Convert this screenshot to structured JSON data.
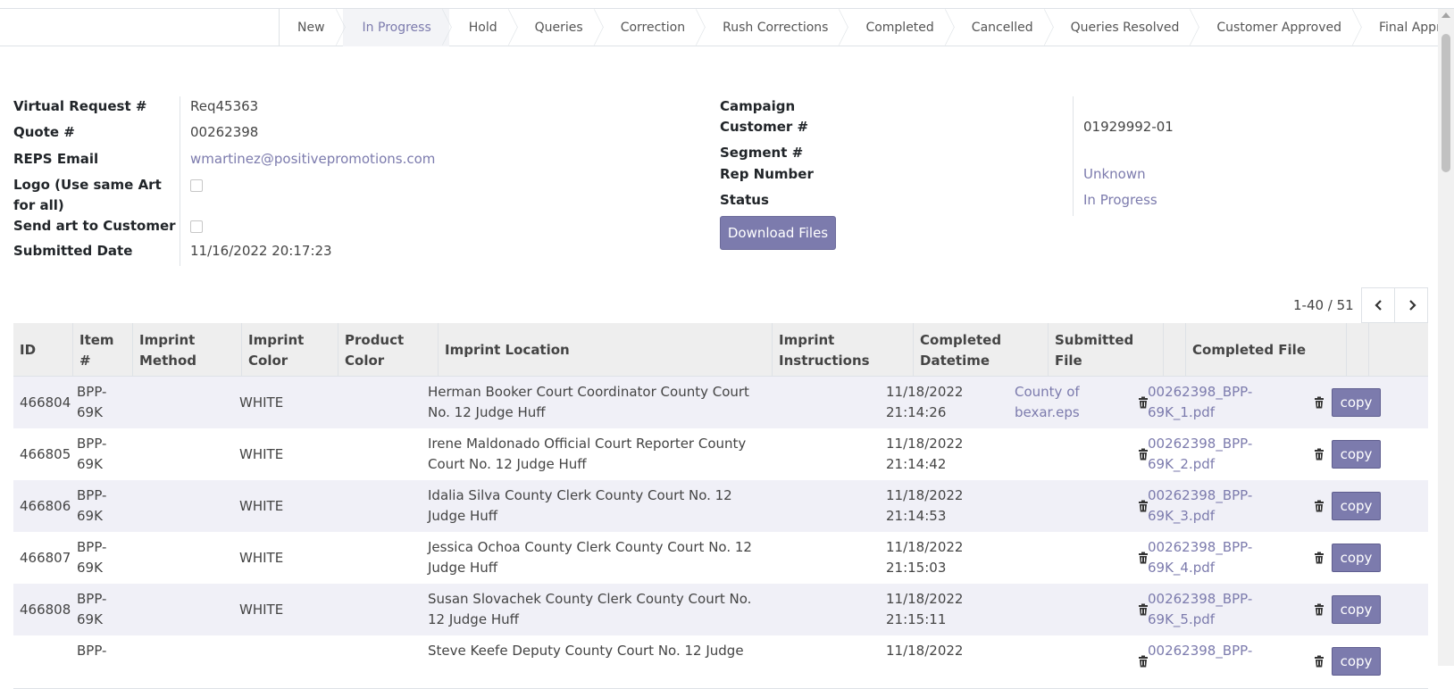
{
  "stages": [
    {
      "label": "New"
    },
    {
      "label": "In Progress",
      "active": true
    },
    {
      "label": "Hold"
    },
    {
      "label": "Queries"
    },
    {
      "label": "Correction"
    },
    {
      "label": "Rush Corrections"
    },
    {
      "label": "Completed"
    },
    {
      "label": "Cancelled"
    },
    {
      "label": "Queries Resolved"
    },
    {
      "label": "Customer Approved"
    },
    {
      "label": "Final Approved"
    }
  ],
  "form": {
    "virtual_request_label": "Virtual Request #",
    "virtual_request_value": "Req45363",
    "quote_label": "Quote #",
    "quote_value": "00262398",
    "reps_email_label": "REPS Email",
    "reps_email_value": "wmartinez@positivepromotions.com",
    "logo_label_line1": "Logo (Use same Art",
    "logo_label_line2": "for all)",
    "send_art_label": "Send art to Customer",
    "submitted_date_label": "Submitted Date",
    "submitted_date_value": "11/16/2022 20:17:23",
    "campaign_label": "Campaign",
    "customer_label": "Customer #",
    "customer_value": "01929992-01",
    "segment_label": "Segment #",
    "rep_number_label": "Rep Number",
    "rep_number_value": "Unknown",
    "status_label": "Status",
    "status_value": "In Progress",
    "download_button": "Download Files"
  },
  "pager": {
    "text": "1-40 / 51"
  },
  "table": {
    "headers": {
      "id": "ID",
      "item_1": "Item",
      "item_2": "#",
      "method_1": "Imprint",
      "method_2": "Method",
      "icolor_1": "Imprint",
      "icolor_2": "Color",
      "pcolor_1": "Product",
      "pcolor_2": "Color",
      "location": "Imprint Location",
      "instr_1": "Imprint",
      "instr_2": "Instructions",
      "completed_1": "Completed",
      "completed_2": "Datetime",
      "submitted_1": "Submitted",
      "submitted_2": "File",
      "completed_file": "Completed File"
    },
    "copy_label": "copy",
    "rows": [
      {
        "id": "466804",
        "item_1": "BPP-",
        "item_2": "69K",
        "imprint_color": "WHITE",
        "loc_1": "Herman Booker Court Coordinator County Court",
        "loc_2": "No. 12 Judge Huff",
        "dt_1": "11/18/2022",
        "dt_2": "21:14:26",
        "sub_1": "County of",
        "sub_2": "bexar.eps",
        "file_1": "00262398_BPP-",
        "file_2": "69K_1.pdf"
      },
      {
        "id": "466805",
        "item_1": "BPP-",
        "item_2": "69K",
        "imprint_color": "WHITE",
        "loc_1": "Irene Maldonado Official Court Reporter County",
        "loc_2": "Court No. 12 Judge Huff",
        "dt_1": "11/18/2022",
        "dt_2": "21:14:42",
        "sub_1": "",
        "sub_2": "",
        "file_1": "00262398_BPP-",
        "file_2": "69K_2.pdf"
      },
      {
        "id": "466806",
        "item_1": "BPP-",
        "item_2": "69K",
        "imprint_color": "WHITE",
        "loc_1": "Idalia Silva County Clerk County Court No. 12",
        "loc_2": "Judge Huff",
        "dt_1": "11/18/2022",
        "dt_2": "21:14:53",
        "sub_1": "",
        "sub_2": "",
        "file_1": "00262398_BPP-",
        "file_2": "69K_3.pdf"
      },
      {
        "id": "466807",
        "item_1": "BPP-",
        "item_2": "69K",
        "imprint_color": "WHITE",
        "loc_1": "Jessica Ochoa County Clerk County Court No. 12",
        "loc_2": "Judge Huff",
        "dt_1": "11/18/2022",
        "dt_2": "21:15:03",
        "sub_1": "",
        "sub_2": "",
        "file_1": "00262398_BPP-",
        "file_2": "69K_4.pdf"
      },
      {
        "id": "466808",
        "item_1": "BPP-",
        "item_2": "69K",
        "imprint_color": "WHITE",
        "loc_1": "Susan Slovachek County Clerk County Court No.",
        "loc_2": "12 Judge Huff",
        "dt_1": "11/18/2022",
        "dt_2": "21:15:11",
        "sub_1": "",
        "sub_2": "",
        "file_1": "00262398_BPP-",
        "file_2": "69K_5.pdf"
      },
      {
        "id": "",
        "item_1": "BPP-",
        "item_2": "",
        "imprint_color": "",
        "loc_1": "Steve Keefe Deputy County Court No. 12 Judge",
        "loc_2": "",
        "dt_1": "11/18/2022",
        "dt_2": "",
        "sub_1": "",
        "sub_2": "",
        "file_1": "00262398_BPP-",
        "file_2": ""
      }
    ]
  }
}
